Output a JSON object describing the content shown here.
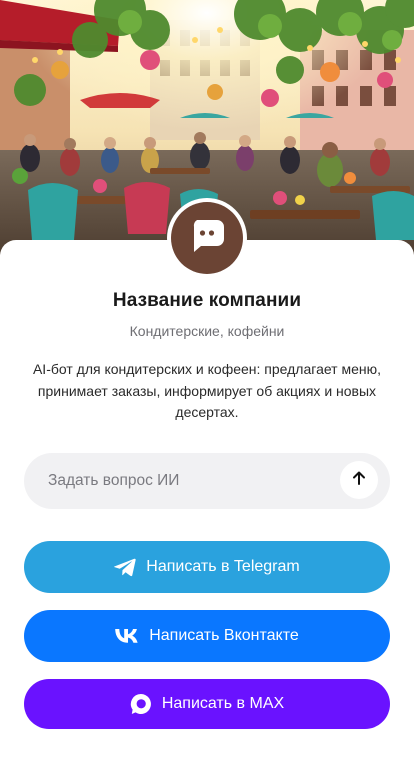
{
  "hero": {
    "icon": "cafe-street-illustration"
  },
  "company": {
    "avatar_icon": "chat-bubble-icon",
    "name": "Название компании",
    "category": "Кондитерские, кофейни",
    "description": "AI-бот для кондитерских и кофеен: предлагает меню, принимает заказы, информирует об акциях и новых десертах."
  },
  "ask": {
    "placeholder": "Задать вопрос ИИ",
    "value": "",
    "send_icon": "arrow-up-icon"
  },
  "buttons": {
    "telegram": {
      "label": "Написать в Telegram",
      "icon": "telegram-icon",
      "color": "#2aa2de"
    },
    "vk": {
      "label": "Написать Вконтакте",
      "icon": "vk-icon",
      "color": "#0a77ff"
    },
    "max": {
      "label": "Написать в MAX",
      "icon": "max-icon",
      "color": "#6a12ff"
    }
  },
  "colors": {
    "avatar_bg": "#6b4434",
    "ask_bg": "#f1f1f3",
    "title": "#1a1a1a",
    "subtitle": "#6e6e73"
  }
}
